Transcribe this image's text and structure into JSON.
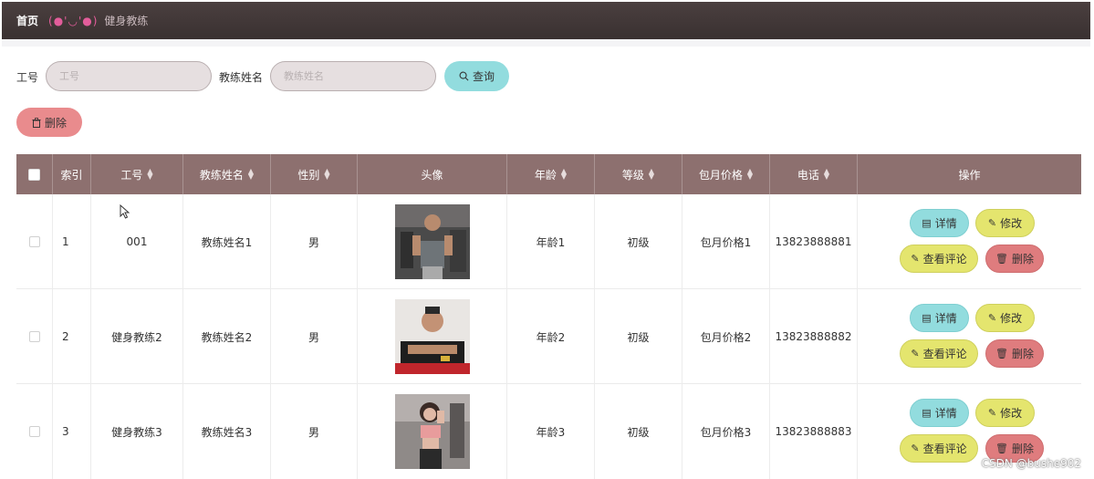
{
  "breadcrumb": {
    "home": "首页",
    "separator": "(●'◡'●)",
    "current": "健身教练"
  },
  "search": {
    "id_label": "工号",
    "id_placeholder": "工号",
    "name_label": "教练姓名",
    "name_placeholder": "教练姓名",
    "search_button": "查询",
    "search_icon": "search-icon"
  },
  "toolbar": {
    "delete_button": "删除",
    "delete_icon": "trash-icon"
  },
  "table": {
    "columns": [
      "索引",
      "工号",
      "教练姓名",
      "性别",
      "头像",
      "年龄",
      "等级",
      "包月价格",
      "电话",
      "操作"
    ],
    "rows": [
      {
        "index": "1",
        "id": "001",
        "name": "教练姓名1",
        "gender": "男",
        "age": "年龄1",
        "level": "初级",
        "price": "包月价格1",
        "phone": "13823888881"
      },
      {
        "index": "2",
        "id": "健身教练2",
        "name": "教练姓名2",
        "gender": "男",
        "age": "年龄2",
        "level": "初级",
        "price": "包月价格2",
        "phone": "13823888882"
      },
      {
        "index": "3",
        "id": "健身教练3",
        "name": "教练姓名3",
        "gender": "男",
        "age": "年龄3",
        "level": "初级",
        "price": "包月价格3",
        "phone": "13823888883"
      }
    ],
    "actions": {
      "detail": "详情",
      "edit": "修改",
      "comment": "查看评论",
      "delete": "删除"
    }
  },
  "watermark": "CSDN @bushe902",
  "colors": {
    "topbar": "#3d3434",
    "header_bg": "#8d706f",
    "accent_cyan": "#92dcde",
    "accent_yellow": "#e4e56e",
    "accent_red": "#df7c7e",
    "breadcrumb_sep": "#e35d9b"
  }
}
